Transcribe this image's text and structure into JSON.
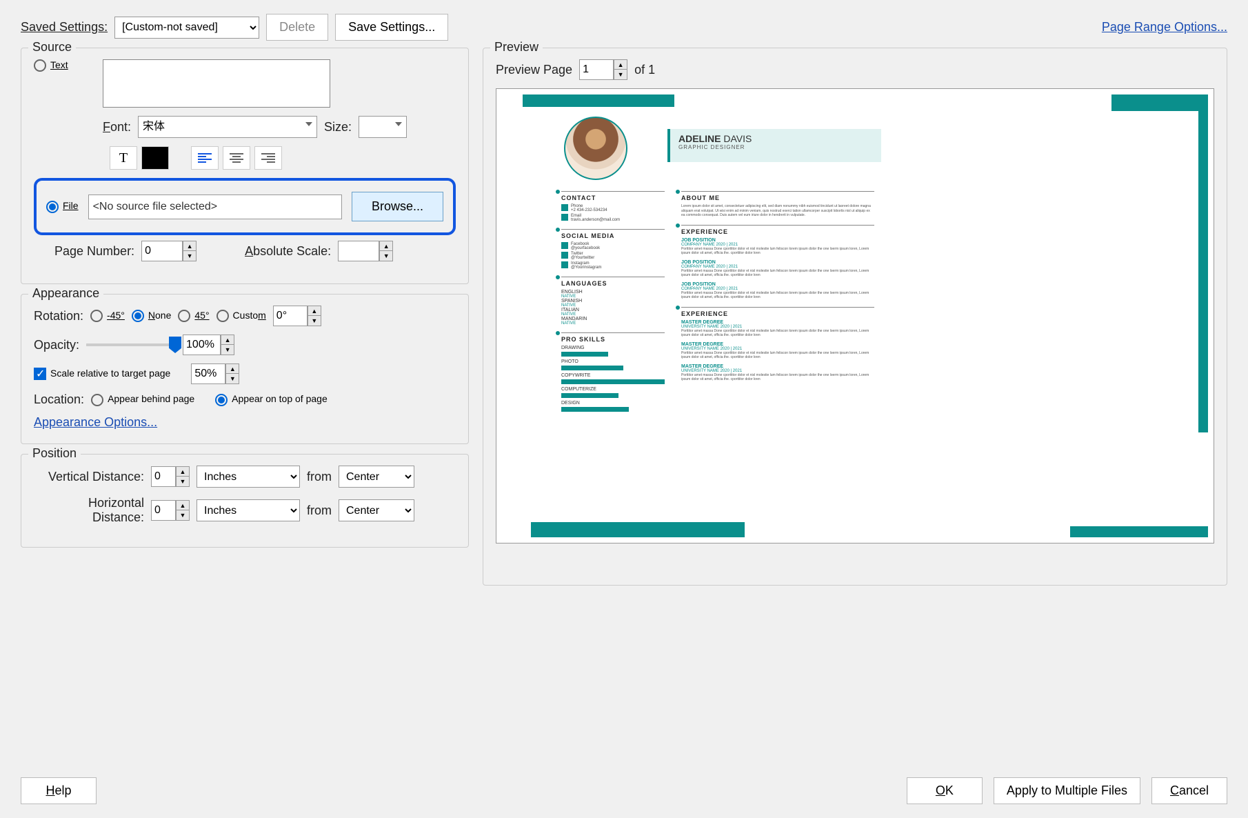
{
  "header": {
    "saved_settings_label": "Saved Settings:",
    "saved_settings_value": "[Custom-not saved]",
    "delete_btn": "Delete",
    "save_settings_btn": "Save Settings...",
    "page_range_link": "Page Range Options..."
  },
  "source": {
    "title": "Source",
    "text_radio": "Text",
    "font_label": "Font:",
    "font_value": "宋体",
    "size_label": "Size:",
    "file_radio": "File",
    "file_value": "<No source file selected>",
    "browse_btn": "Browse...",
    "page_number_label": "Page Number:",
    "page_number_value": "0",
    "absolute_scale_label": "Absolute Scale:"
  },
  "appearance": {
    "title": "Appearance",
    "rotation_label": "Rotation:",
    "rot_neg45": "-45°",
    "rot_none": "None",
    "rot_45": "45°",
    "rot_custom": "Custom",
    "rot_value": "0°",
    "opacity_label": "Opacity:",
    "opacity_value": "100%",
    "scale_label": "Scale relative to target page",
    "scale_value": "50%",
    "location_label": "Location:",
    "loc_behind": "Appear behind page",
    "loc_top": "Appear on top of page",
    "options_link": "Appearance Options..."
  },
  "position": {
    "title": "Position",
    "vdist_label": "Vertical Distance:",
    "vdist_value": "0",
    "hdist_label": "Horizontal Distance:",
    "hdist_value": "0",
    "unit": "Inches",
    "from_label": "from",
    "from_value": "Center"
  },
  "preview": {
    "title": "Preview",
    "page_label": "Preview Page",
    "page_value": "1",
    "of_text": "of 1"
  },
  "resume": {
    "name_first": "ADELINE",
    "name_last": "DAVIS",
    "title": "GRAPHIC DESIGNER",
    "contact": "CONTACT",
    "phone_lbl": "Phone",
    "phone": "+2 434-232-534234",
    "email_lbl": "Email",
    "email": "travis.anderson@mail.com",
    "about": "ABOUT ME",
    "about_body": "Lorem ipsum dolor sit amet, consectetuer adipiscing elit, sed diam nonummy nibh euismod tincidunt ut laoreet dolore magna aliquam erat volutpat. Ut wisi enim ad minim veniam, quis nostrud exerci tation ullamcorper suscipit lobortis nisl ut aliquip ex ea commodo consequat. Duis autem vel eum iriure dolor in hendrerit in vulputate.",
    "social": "SOCIAL MEDIA",
    "fb": "Facebook",
    "fb_h": "@yourfacebook",
    "tw": "Twitter",
    "tw_h": "@Yourtwitter",
    "ig": "Instagram",
    "ig_h": "@Yourinstagram",
    "exp": "EXPERIENCE",
    "job": "JOB POSITION",
    "company": "COMPANY NAME 2020 | 2021",
    "lorem_p": "Porttitor amet massa Done cporttitor dolor et nisl molestie lum feliscon lorem ipsum dolor the one loerm ipsum loren, Lorem ipsum dolor sit amet, officia the. cporttitor dolor kren",
    "lang": "LANGUAGES",
    "langs": [
      "ENGLISH",
      "SPANISH",
      "ITALIAN",
      "MANDARIN"
    ],
    "native": "NATIVE",
    "edu": "EXPERIENCE",
    "degree": "MASTER DEGREE",
    "uni": "UNIVERSITY NAME 2020 | 2021",
    "skills": "PRO SKILLS",
    "skill_list": [
      "DRAWING",
      "PHOTO",
      "COPYWRITE",
      "COMPUTERIZE",
      "DESIGN"
    ],
    "skill_widths": [
      45,
      60,
      100,
      55,
      65
    ]
  },
  "footer": {
    "help": "Help",
    "ok": "OK",
    "apply": "Apply to Multiple Files",
    "cancel": "Cancel"
  }
}
